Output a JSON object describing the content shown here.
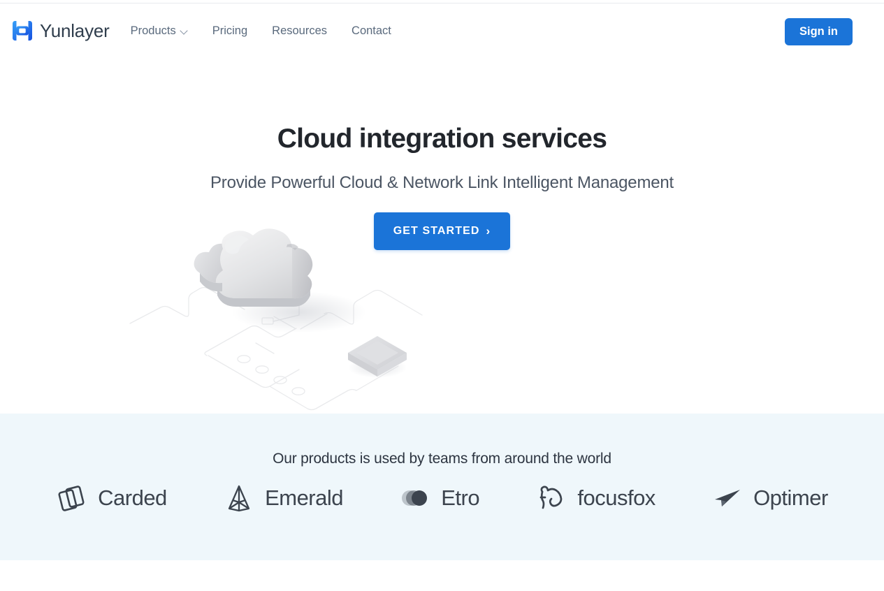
{
  "site": {
    "brand_name": "Yunlayer",
    "logo_icon": "yunlayer-logo-mark"
  },
  "header": {
    "nav": [
      {
        "label": "Products",
        "has_dropdown": true,
        "icon": "chevron-down-icon"
      },
      {
        "label": "Pricing",
        "has_dropdown": false
      },
      {
        "label": "Resources",
        "has_dropdown": false
      },
      {
        "label": "Contact",
        "has_dropdown": false
      }
    ],
    "signin_label": "Sign in"
  },
  "hero": {
    "title": "Cloud integration services",
    "subtitle": "Provide Powerful Cloud & Network Link Intelligent Management",
    "cta_label": "GET STARTED",
    "cta_arrow": "›",
    "illustration": "isometric-cloud-network-diagram"
  },
  "brands": {
    "tagline": "Our products is used by teams from around the world",
    "items": [
      {
        "name": "Carded",
        "icon": "stacked-cards-icon"
      },
      {
        "name": "Emerald",
        "icon": "gem-crystal-icon"
      },
      {
        "name": "Etro",
        "icon": "overlapping-circles-icon"
      },
      {
        "name": "focusfox",
        "icon": "fox-head-icon"
      },
      {
        "name": "Optimer",
        "icon": "paper-plane-icon"
      }
    ]
  },
  "colors": {
    "accent_blue": "#1b74d8",
    "brand_logo_blue": "#1f7bef",
    "heading_dark": "#22262c",
    "body_gray": "#4b5563",
    "nav_gray": "#5a6a7d",
    "brands_bg": "#eff7fb",
    "brand_mark_gray": "#3c444e",
    "page_bg": "#ffffff"
  }
}
